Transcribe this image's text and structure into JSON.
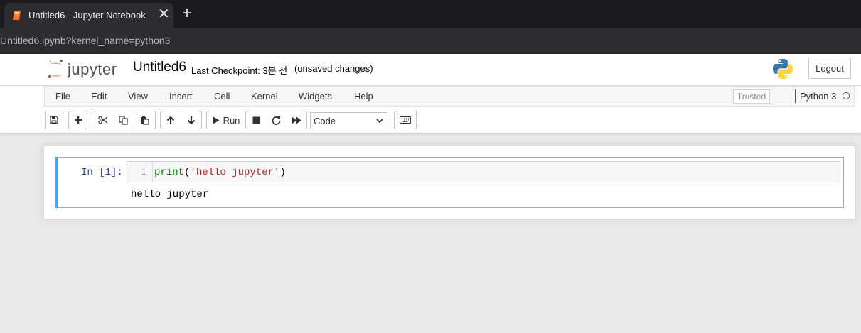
{
  "browser": {
    "tab_title": "Untitled6 - Jupyter Notebook",
    "close_glyph": "✕",
    "new_tab_glyph": "+",
    "url": "Untitled6.ipynb?kernel_name=python3"
  },
  "header": {
    "logo_text": "jupyter",
    "notebook_name": "Untitled6",
    "checkpoint": "Last Checkpoint: 3분 전",
    "unsaved": "(unsaved changes)",
    "logout_label": "Logout",
    "logo_colors": {
      "orange": "#f37726",
      "gray": "#616262"
    }
  },
  "menubar": {
    "items": [
      "File",
      "Edit",
      "View",
      "Insert",
      "Cell",
      "Kernel",
      "Widgets",
      "Help"
    ],
    "trusted_label": "Trusted",
    "kernel_name": "Python 3"
  },
  "toolbar": {
    "run_label": "Run",
    "cell_type": "Code",
    "icons": [
      "save-icon",
      "plus-icon",
      "cut-icon",
      "copy-icon",
      "paste-icon",
      "arrow-up-icon",
      "arrow-down-icon",
      "play-icon",
      "stop-icon",
      "restart-icon",
      "fast-forward-icon",
      "keyboard-icon"
    ]
  },
  "cell": {
    "prompt": "In [1]:",
    "line_number": "1",
    "code_func": "print",
    "code_open": "(",
    "code_string": "'hello jupyter'",
    "code_close": ")",
    "output": "hello jupyter",
    "accent": "#42a5f5"
  }
}
